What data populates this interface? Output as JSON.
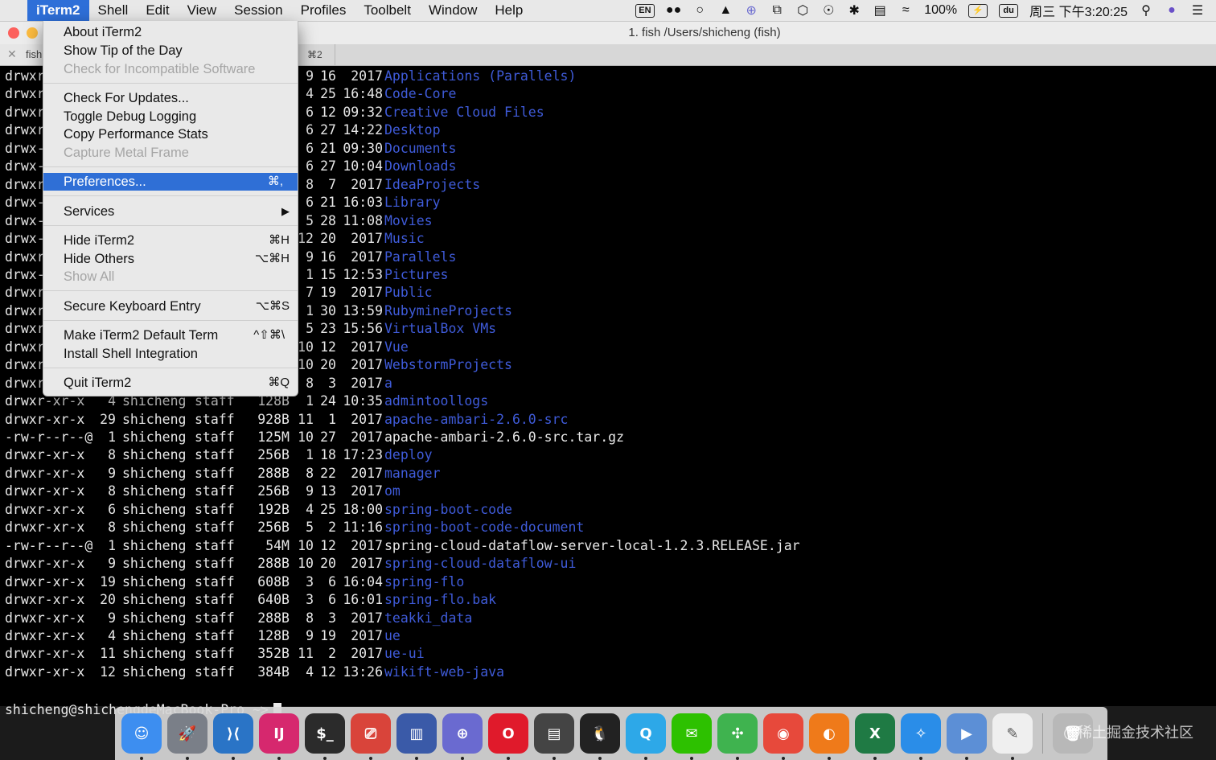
{
  "menubar": {
    "apple": "",
    "app": "iTerm2",
    "items": [
      "Shell",
      "Edit",
      "View",
      "Session",
      "Profiles",
      "Toolbelt",
      "Window",
      "Help"
    ]
  },
  "status": {
    "input": "EN",
    "battery": "100%",
    "du": "du",
    "clock": "周三 下午3:20:25"
  },
  "window": {
    "title": "1. fish  /Users/shicheng (fish)",
    "tab1": "fish",
    "tab2": "⌘2"
  },
  "menu": {
    "about": "About iTerm2",
    "tip": "Show Tip of the Day",
    "incompatible": "Check for Incompatible Software",
    "updates": "Check For Updates...",
    "debug": "Toggle Debug Logging",
    "perf": "Copy Performance Stats",
    "metal": "Capture Metal Frame",
    "prefs": "Preferences...",
    "prefs_key": "⌘,",
    "services": "Services",
    "services_arrow": "▶",
    "hide": "Hide iTerm2",
    "hide_key": "⌘H",
    "hide_others": "Hide Others",
    "hide_others_key": "⌥⌘H",
    "show_all": "Show All",
    "secure": "Secure Keyboard Entry",
    "secure_key": "⌥⌘S",
    "default_term": "Make iTerm2 Default Term",
    "default_term_key": "^⇧⌘\\",
    "shell_integration": "Install Shell Integration",
    "quit": "Quit iTerm2",
    "quit_key": "⌘Q"
  },
  "terminal": {
    "rows": [
      {
        "perm": "drwxr",
        "links": "",
        "owner": "",
        "group": "",
        "size": "",
        "mon": "9",
        "day": "16",
        "time": "2017",
        "name": "Applications (Parallels)",
        "dir": true
      },
      {
        "perm": "drwxr",
        "links": "",
        "owner": "",
        "group": "",
        "size": "",
        "mon": "4",
        "day": "25",
        "time": "16:48",
        "name": "Code-Core",
        "dir": true
      },
      {
        "perm": "drwxr",
        "links": "",
        "owner": "",
        "group": "",
        "size": "",
        "mon": "6",
        "day": "12",
        "time": "09:32",
        "name": "Creative Cloud Files",
        "dir": true
      },
      {
        "perm": "drwxr",
        "links": "",
        "owner": "",
        "group": "",
        "size": "",
        "mon": "6",
        "day": "27",
        "time": "14:22",
        "name": "Desktop",
        "dir": true
      },
      {
        "perm": "drwx-",
        "links": "",
        "owner": "",
        "group": "",
        "size": "",
        "mon": "6",
        "day": "21",
        "time": "09:30",
        "name": "Documents",
        "dir": true
      },
      {
        "perm": "drwx-",
        "links": "",
        "owner": "",
        "group": "",
        "size": "",
        "mon": "6",
        "day": "27",
        "time": "10:04",
        "name": "Downloads",
        "dir": true
      },
      {
        "perm": "drwxr",
        "links": "",
        "owner": "",
        "group": "",
        "size": "",
        "mon": "8",
        "day": "7",
        "time": "2017",
        "name": "IdeaProjects",
        "dir": true
      },
      {
        "perm": "drwx-",
        "links": "",
        "owner": "",
        "group": "",
        "size": "",
        "mon": "6",
        "day": "21",
        "time": "16:03",
        "name": "Library",
        "dir": true
      },
      {
        "perm": "drwx-",
        "links": "",
        "owner": "",
        "group": "",
        "size": "",
        "mon": "5",
        "day": "28",
        "time": "11:08",
        "name": "Movies",
        "dir": true
      },
      {
        "perm": "drwx-",
        "links": "",
        "owner": "",
        "group": "",
        "size": "",
        "mon": "12",
        "day": "20",
        "time": "2017",
        "name": "Music",
        "dir": true
      },
      {
        "perm": "drwxr",
        "links": "",
        "owner": "",
        "group": "",
        "size": "",
        "mon": "9",
        "day": "16",
        "time": "2017",
        "name": "Parallels",
        "dir": true
      },
      {
        "perm": "drwx-",
        "links": "",
        "owner": "",
        "group": "",
        "size": "",
        "mon": "1",
        "day": "15",
        "time": "12:53",
        "name": "Pictures",
        "dir": true
      },
      {
        "perm": "drwxr",
        "links": "",
        "owner": "",
        "group": "",
        "size": "",
        "mon": "7",
        "day": "19",
        "time": "2017",
        "name": "Public",
        "dir": true
      },
      {
        "perm": "drwxr",
        "links": "",
        "owner": "",
        "group": "",
        "size": "",
        "mon": "1",
        "day": "30",
        "time": "13:59",
        "name": "RubymineProjects",
        "dir": true
      },
      {
        "perm": "drwxr",
        "links": "",
        "owner": "",
        "group": "",
        "size": "",
        "mon": "5",
        "day": "23",
        "time": "15:56",
        "name": "VirtualBox VMs",
        "dir": true
      },
      {
        "perm": "drwxr",
        "links": "",
        "owner": "",
        "group": "",
        "size": "",
        "mon": "10",
        "day": "12",
        "time": "2017",
        "name": "Vue",
        "dir": true
      },
      {
        "perm": "drwxr",
        "links": "",
        "owner": "",
        "group": "",
        "size": "",
        "mon": "10",
        "day": "20",
        "time": "2017",
        "name": "WebstormProjects",
        "dir": true
      },
      {
        "perm": "drwxr",
        "links": "",
        "owner": "",
        "group": "",
        "size": "",
        "mon": "8",
        "day": "3",
        "time": "2017",
        "name": "a",
        "dir": true
      },
      {
        "perm": "drwxr-xr-x",
        "links": "4",
        "owner": "shicheng",
        "group": "staff",
        "size": "128B",
        "mon": "1",
        "day": "24",
        "time": "10:35",
        "name": "admintoollogs",
        "dir": true
      },
      {
        "perm": "drwxr-xr-x",
        "links": "29",
        "owner": "shicheng",
        "group": "staff",
        "size": "928B",
        "mon": "11",
        "day": "1",
        "time": "2017",
        "name": "apache-ambari-2.6.0-src",
        "dir": true
      },
      {
        "perm": "-rw-r--r--@",
        "links": "1",
        "owner": "shicheng",
        "group": "staff",
        "size": "125M",
        "mon": "10",
        "day": "27",
        "time": "2017",
        "name": "apache-ambari-2.6.0-src.tar.gz",
        "dir": false
      },
      {
        "perm": "drwxr-xr-x",
        "links": "8",
        "owner": "shicheng",
        "group": "staff",
        "size": "256B",
        "mon": "1",
        "day": "18",
        "time": "17:23",
        "name": "deploy",
        "dir": true
      },
      {
        "perm": "drwxr-xr-x",
        "links": "9",
        "owner": "shicheng",
        "group": "staff",
        "size": "288B",
        "mon": "8",
        "day": "22",
        "time": "2017",
        "name": "manager",
        "dir": true
      },
      {
        "perm": "drwxr-xr-x",
        "links": "8",
        "owner": "shicheng",
        "group": "staff",
        "size": "256B",
        "mon": "9",
        "day": "13",
        "time": "2017",
        "name": "om",
        "dir": true
      },
      {
        "perm": "drwxr-xr-x",
        "links": "6",
        "owner": "shicheng",
        "group": "staff",
        "size": "192B",
        "mon": "4",
        "day": "25",
        "time": "18:00",
        "name": "spring-boot-code",
        "dir": true
      },
      {
        "perm": "drwxr-xr-x",
        "links": "8",
        "owner": "shicheng",
        "group": "staff",
        "size": "256B",
        "mon": "5",
        "day": "2",
        "time": "11:16",
        "name": "spring-boot-code-document",
        "dir": true
      },
      {
        "perm": "-rw-r--r--@",
        "links": "1",
        "owner": "shicheng",
        "group": "staff",
        "size": "54M",
        "mon": "10",
        "day": "12",
        "time": "2017",
        "name": "spring-cloud-dataflow-server-local-1.2.3.RELEASE.jar",
        "dir": false
      },
      {
        "perm": "drwxr-xr-x",
        "links": "9",
        "owner": "shicheng",
        "group": "staff",
        "size": "288B",
        "mon": "10",
        "day": "20",
        "time": "2017",
        "name": "spring-cloud-dataflow-ui",
        "dir": true
      },
      {
        "perm": "drwxr-xr-x",
        "links": "19",
        "owner": "shicheng",
        "group": "staff",
        "size": "608B",
        "mon": "3",
        "day": "6",
        "time": "16:04",
        "name": "spring-flo",
        "dir": true
      },
      {
        "perm": "drwxr-xr-x",
        "links": "20",
        "owner": "shicheng",
        "group": "staff",
        "size": "640B",
        "mon": "3",
        "day": "6",
        "time": "16:01",
        "name": "spring-flo.bak",
        "dir": true
      },
      {
        "perm": "drwxr-xr-x",
        "links": "9",
        "owner": "shicheng",
        "group": "staff",
        "size": "288B",
        "mon": "8",
        "day": "3",
        "time": "2017",
        "name": "teakki_data",
        "dir": true
      },
      {
        "perm": "drwxr-xr-x",
        "links": "4",
        "owner": "shicheng",
        "group": "staff",
        "size": "128B",
        "mon": "9",
        "day": "19",
        "time": "2017",
        "name": "ue",
        "dir": true
      },
      {
        "perm": "drwxr-xr-x",
        "links": "11",
        "owner": "shicheng",
        "group": "staff",
        "size": "352B",
        "mon": "11",
        "day": "2",
        "time": "2017",
        "name": "ue-ui",
        "dir": true
      },
      {
        "perm": "drwxr-xr-x",
        "links": "12",
        "owner": "shicheng",
        "group": "staff",
        "size": "384B",
        "mon": "4",
        "day": "12",
        "time": "13:26",
        "name": "wikift-web-java",
        "dir": true
      }
    ],
    "prompt": "shicheng@shichengdeMacBook-Pro ~>"
  },
  "dock": {
    "items": [
      {
        "name": "finder",
        "glyph": "☺",
        "color": "#3d8ef0"
      },
      {
        "name": "launchpad",
        "glyph": "🚀",
        "color": "#7a7f88"
      },
      {
        "name": "vscode",
        "glyph": "⟩⟨",
        "color": "#2a74c6"
      },
      {
        "name": "intellij",
        "glyph": "IJ",
        "color": "#d6286e"
      },
      {
        "name": "terminal",
        "glyph": "$_",
        "color": "#2b2b2b"
      },
      {
        "name": "remote-desktop",
        "glyph": "⎚",
        "color": "#d9443a"
      },
      {
        "name": "bars-app",
        "glyph": "▥",
        "color": "#3a5aa8"
      },
      {
        "name": "crosshair-app",
        "glyph": "⊕",
        "color": "#6a6ad0"
      },
      {
        "name": "opera",
        "glyph": "O",
        "color": "#e01a2b"
      },
      {
        "name": "activity-monitor",
        "glyph": "▤",
        "color": "#444444"
      },
      {
        "name": "qq",
        "glyph": "🐧",
        "color": "#222222"
      },
      {
        "name": "qq-browser",
        "glyph": "Q",
        "color": "#2da8e8"
      },
      {
        "name": "wechat",
        "glyph": "✉",
        "color": "#2dc100"
      },
      {
        "name": "xmind",
        "glyph": "✣",
        "color": "#3fb34f"
      },
      {
        "name": "chrome",
        "glyph": "◉",
        "color": "#e7493b"
      },
      {
        "name": "firefox",
        "glyph": "◐",
        "color": "#ef7a1a"
      },
      {
        "name": "excel",
        "glyph": "X",
        "color": "#1f7a44"
      },
      {
        "name": "safari",
        "glyph": "✧",
        "color": "#2a8de8"
      },
      {
        "name": "preview",
        "glyph": "▶",
        "color": "#5c8fd6"
      },
      {
        "name": "textedit",
        "glyph": "✎",
        "color": "#efefef"
      }
    ],
    "trash": {
      "name": "trash",
      "glyph": "🗑",
      "color": "#b8b8b8"
    }
  },
  "watermark": "@稀土掘金技术社区"
}
